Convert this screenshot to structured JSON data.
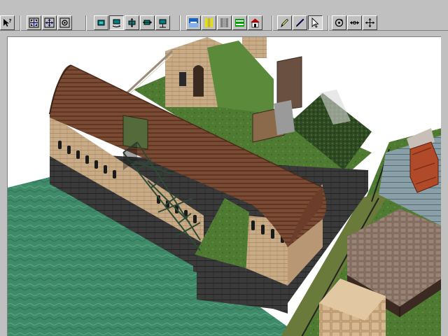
{
  "toolbar": {
    "groups": [
      {
        "name": "help",
        "buttons": [
          {
            "icon": "help-pointer-icon"
          }
        ]
      },
      {
        "name": "view",
        "buttons": [
          {
            "icon": "zoom-extents-icon"
          },
          {
            "icon": "zoom-all-icon"
          },
          {
            "icon": "camera-icon"
          }
        ]
      },
      {
        "name": "mode",
        "buttons": [
          {
            "icon": "select-object-icon"
          },
          {
            "icon": "select-rotate-icon",
            "pressed": true
          },
          {
            "icon": "move-xy-icon"
          },
          {
            "icon": "scale-icon"
          },
          {
            "icon": "move-z-icon"
          }
        ]
      },
      {
        "name": "render",
        "buttons": [
          {
            "icon": "sky-icon"
          },
          {
            "icon": "texture-yellow-icon"
          },
          {
            "icon": "texture-gray-icon"
          },
          {
            "icon": "texture-green-icon"
          },
          {
            "icon": "house-icon"
          }
        ]
      },
      {
        "name": "tools",
        "buttons": [
          {
            "icon": "pencil-icon"
          },
          {
            "icon": "brush-icon"
          },
          {
            "icon": "arrow-pointer-icon",
            "pressed": true
          }
        ]
      },
      {
        "name": "navigate",
        "buttons": [
          {
            "icon": "orbit-icon"
          },
          {
            "icon": "pan-icon"
          },
          {
            "icon": "move-4way-icon"
          }
        ]
      }
    ]
  },
  "colors": {
    "toolbar_bg": "#c0c0c0",
    "roof": "#7a4a32",
    "wall": "#c8a882",
    "grass": "#4f7a32",
    "water": "#3f8a68",
    "stone_base": "#3c3c3c",
    "crate": "#b04a28"
  }
}
